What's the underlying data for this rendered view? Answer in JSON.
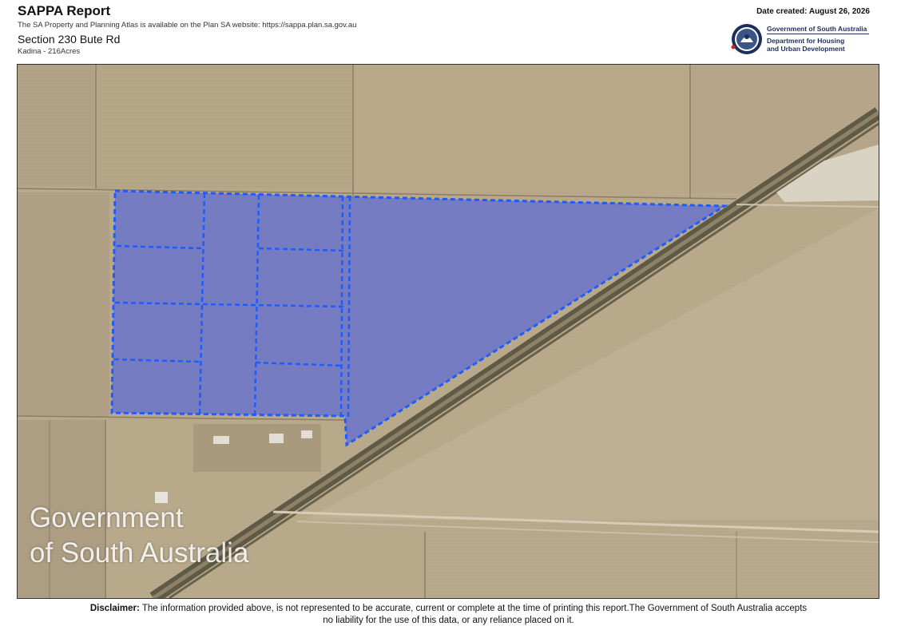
{
  "header": {
    "title": "SAPPA Report",
    "subtitle": "The SA Property and Planning Atlas is available on the Plan SA website: https://sappa.plan.sa.gov.au",
    "section": "Section 230 Bute Rd",
    "locality": "Kadina - 216Acres",
    "date_created": "Date created: August 26, 2026"
  },
  "logo": {
    "line1": "Government of South Australia",
    "line2a": "Department for Housing",
    "line2b": "and Urban Development"
  },
  "map": {
    "watermark_line1": "Government",
    "watermark_line2": "of South Australia",
    "parcel_fill": "#5b6bd6",
    "boundary_color": "#1f5cff"
  },
  "disclaimer": {
    "label": "Disclaimer:",
    "line1": "The information provided above, is not represented to be accurate, current or complete at the time of printing this report.The Government of South Australia accepts",
    "line2": "no liability for the use of this data, or any reliance placed on it."
  }
}
